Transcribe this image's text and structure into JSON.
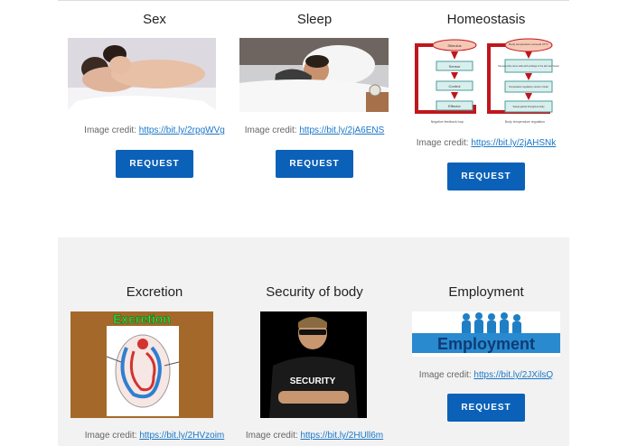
{
  "row1": [
    {
      "title": "Sex",
      "credit_label": "Image credit:",
      "credit_link": "https://bit.ly/2rpgWVg",
      "button": "REQUEST"
    },
    {
      "title": "Sleep",
      "credit_label": "Image credit:",
      "credit_link": "https://bit.ly/2jA6ENS",
      "button": "REQUEST"
    },
    {
      "title": "Homeostasis",
      "credit_label": "Image credit:",
      "credit_link": "https://bit.ly/2jAHSNk",
      "button": "REQUEST",
      "diagram": {
        "left_top": "Stimulus",
        "left_boxes": [
          "Sensor",
          "Control",
          "Effector"
        ],
        "left_caption": "Negative feedback loop",
        "right_top": "Body temperature exceeds 37°C",
        "right_boxes": [
          "Sensors (the nerve cells with endings in the skin and brain)",
          "Temperature regulatory center in brain",
          "Sweat glands throughout body"
        ],
        "right_caption": "Body temperature regulation"
      }
    }
  ],
  "row2": [
    {
      "title": "Excretion",
      "credit_label": "Image credit:",
      "credit_link": "https://bit.ly/2HVzoim",
      "image_text": "Excretion"
    },
    {
      "title": "Security of body",
      "credit_label": "Image credit:",
      "credit_link": "https://bit.ly/2HUll6m",
      "image_text": "SECURITY"
    },
    {
      "title": "Employment",
      "credit_label": "Image credit:",
      "credit_link": "https://bit.ly/2JXilsQ",
      "button": "REQUEST",
      "image_text": "Employment"
    }
  ],
  "colors": {
    "button": "#0b61b8",
    "link": "#1976c8",
    "bottom_panel": "#f2f2f2"
  }
}
